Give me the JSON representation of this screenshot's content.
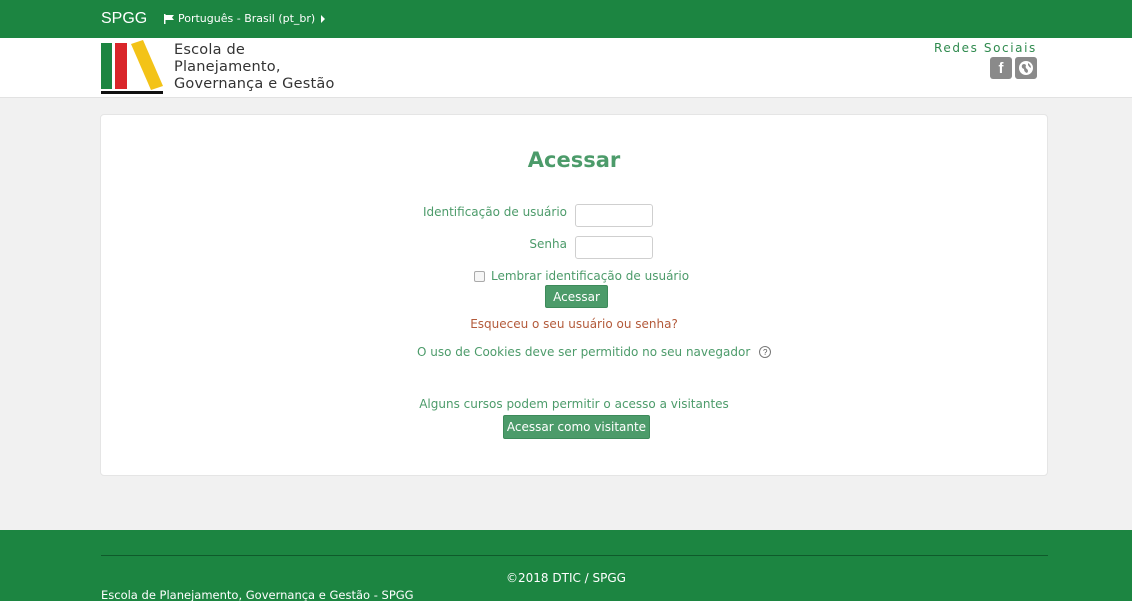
{
  "navbar": {
    "brand": "SPGG",
    "language": "Português - Brasil (pt_br)"
  },
  "header": {
    "logo_lines": [
      "Escola de",
      "Planejamento,",
      "Governança e Gestão"
    ],
    "social_title": "Redes Sociais",
    "social_icons": [
      "facebook-icon",
      "globe-icon"
    ]
  },
  "login": {
    "title": "Acessar",
    "username_label": "Identificação de usuário",
    "username_value": "",
    "password_label": "Senha",
    "password_value": "",
    "remember_label": "Lembrar identificação de usuário",
    "submit_label": "Acessar",
    "forgot_link": "Esqueceu o seu usuário ou senha?",
    "cookies_text": "O uso de Cookies deve ser permitido no seu navegador",
    "guest_text": "Alguns cursos podem permitir o acesso a visitantes",
    "guest_button": "Acessar como visitante"
  },
  "footer": {
    "copyright": "©2018 DTIC / SPGG",
    "site_name": "Escola de Planejamento, Governança e Gestão - SPGG"
  },
  "colors": {
    "brand_green": "#1c8541",
    "accent_green": "#4c9b6a",
    "link_red": "#b35a3a"
  }
}
